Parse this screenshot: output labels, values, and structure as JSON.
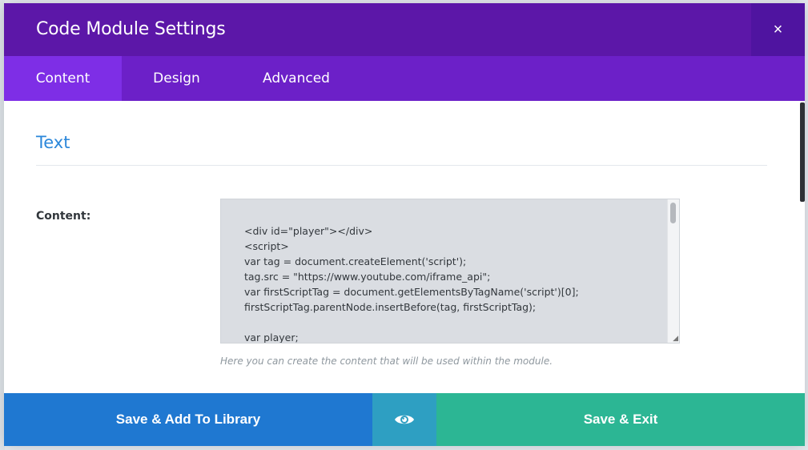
{
  "modal": {
    "title": "Code Module Settings",
    "close_symbol": "×"
  },
  "tabs": [
    {
      "label": "Content",
      "active": true
    },
    {
      "label": "Design",
      "active": false
    },
    {
      "label": "Advanced",
      "active": false
    }
  ],
  "section": {
    "title": "Text"
  },
  "content_field": {
    "label": "Content:",
    "value": "<div id=\"player\"></div>\n<script>\nvar tag = document.createElement('script');\ntag.src = \"https://www.youtube.com/iframe_api\";\nvar firstScriptTag = document.getElementsByTagName('script')[0];\nfirstScriptTag.parentNode.insertBefore(tag, firstScriptTag);\n\nvar player;",
    "description": "Here you can create the content that will be used within the module."
  },
  "footer": {
    "save_library_label": "Save & Add To Library",
    "preview_icon": "eye-icon",
    "save_exit_label": "Save & Exit"
  },
  "colors": {
    "header": "#5c17a8",
    "tabs": "#6c20c8",
    "active_tab": "#7e2ee6",
    "section_title": "#2b87da",
    "library_button": "#1f78d1",
    "preview_button": "#2e9fc2",
    "save_exit_button": "#2cb694"
  }
}
